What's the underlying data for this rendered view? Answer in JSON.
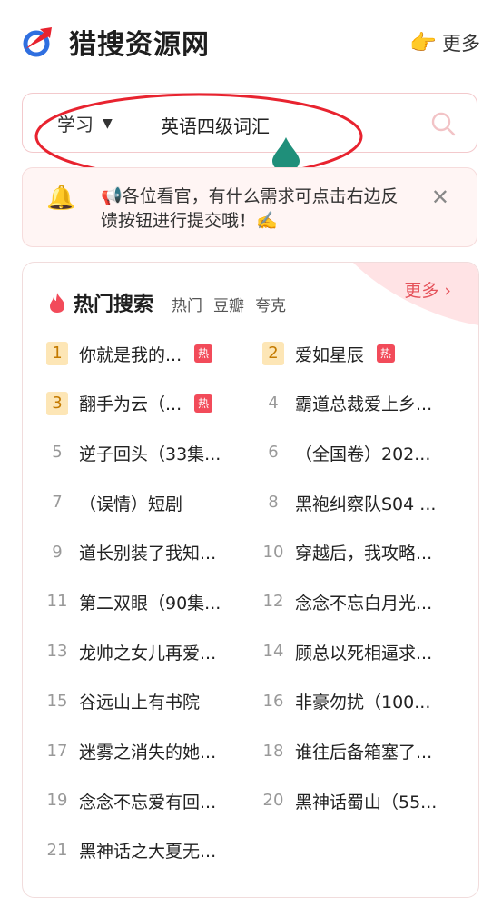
{
  "header": {
    "title": "猎搜资源网",
    "more_label": "更多",
    "more_icon": "pointing-hand"
  },
  "search": {
    "category": "学习",
    "query": "英语四级词汇"
  },
  "notice": {
    "text": "📢各位看官，有什么需求可点击右边反馈按钮进行提交哦！✍️"
  },
  "hot": {
    "title": "热门搜索",
    "tabs": [
      "热门",
      "豆瓣",
      "夸克"
    ],
    "more_label": "更多 ›",
    "badge_label": "热",
    "items": [
      {
        "rank": "1",
        "name": "你就是我的...",
        "hot": true
      },
      {
        "rank": "2",
        "name": "爱如星辰",
        "hot": true
      },
      {
        "rank": "3",
        "name": "翻手为云（...",
        "hot": true
      },
      {
        "rank": "4",
        "name": "霸道总裁爱上乡...",
        "hot": false
      },
      {
        "rank": "5",
        "name": "逆子回头（33集...",
        "hot": false
      },
      {
        "rank": "6",
        "name": "（全国卷）202...",
        "hot": false
      },
      {
        "rank": "7",
        "name": "（误情）短剧",
        "hot": false
      },
      {
        "rank": "8",
        "name": "黑袍纠察队S04 ...",
        "hot": false
      },
      {
        "rank": "9",
        "name": "道长别装了我知...",
        "hot": false
      },
      {
        "rank": "10",
        "name": "穿越后，我攻略...",
        "hot": false
      },
      {
        "rank": "11",
        "name": "第二双眼（90集...",
        "hot": false
      },
      {
        "rank": "12",
        "name": "念念不忘白月光...",
        "hot": false
      },
      {
        "rank": "13",
        "name": "龙帅之女儿再爱...",
        "hot": false
      },
      {
        "rank": "14",
        "name": "顾总以死相逼求...",
        "hot": false
      },
      {
        "rank": "15",
        "name": "谷远山上有书院",
        "hot": false
      },
      {
        "rank": "16",
        "name": "非豪勿扰（100...",
        "hot": false
      },
      {
        "rank": "17",
        "name": "迷雾之消失的她...",
        "hot": false
      },
      {
        "rank": "18",
        "name": "谁往后备箱塞了...",
        "hot": false
      },
      {
        "rank": "19",
        "name": "念念不忘爱有回...",
        "hot": false
      },
      {
        "rank": "20",
        "name": "黑神话蜀山（55...",
        "hot": false
      },
      {
        "rank": "21",
        "name": "黑神话之大夏无...",
        "hot": false
      }
    ]
  },
  "colors": {
    "accent": "#e5525a",
    "rank_top_bg": "#fde6b6",
    "annotation_red": "#e8232f",
    "annotation_teal": "#1f8f7a"
  }
}
